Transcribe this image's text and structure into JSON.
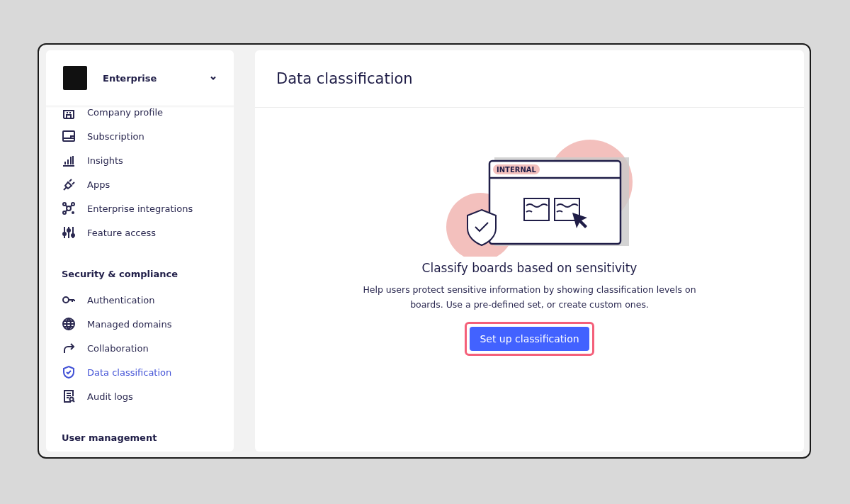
{
  "sidebar": {
    "org": {
      "name": "Enterprise"
    },
    "sections": [
      {
        "items": [
          {
            "label": "Company profile",
            "kind": "building",
            "selected": false
          },
          {
            "label": "Subscription",
            "kind": "card",
            "selected": false
          },
          {
            "label": "Insights",
            "kind": "chart",
            "selected": false
          },
          {
            "label": "Apps",
            "kind": "plug",
            "selected": false
          },
          {
            "label": "Enterprise integrations",
            "kind": "nodes",
            "selected": false
          },
          {
            "label": "Feature access",
            "kind": "sliders",
            "selected": false
          }
        ]
      },
      {
        "title": "Security & compliance",
        "items": [
          {
            "label": "Authentication",
            "kind": "key",
            "selected": false
          },
          {
            "label": "Managed domains",
            "kind": "globe",
            "selected": false
          },
          {
            "label": "Collaboration",
            "kind": "share",
            "selected": false
          },
          {
            "label": "Data classification",
            "kind": "shield",
            "selected": true
          },
          {
            "label": "Audit logs",
            "kind": "log",
            "selected": false
          }
        ]
      },
      {
        "title": "User management"
      }
    ]
  },
  "main": {
    "title": "Data classification",
    "illustration": {
      "tag": "INTERNAL"
    },
    "heading": "Classify boards based on sensitivity",
    "description": "Help users protect sensitive information by showing classification levels on boards. Use a pre-defined set, or create custom ones.",
    "button": {
      "label": "Set up classification",
      "highlighted": true
    }
  }
}
